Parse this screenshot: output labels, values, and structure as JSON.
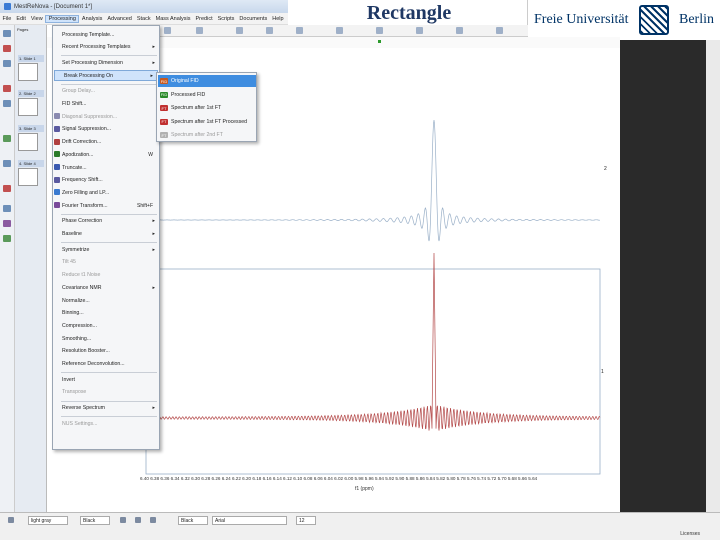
{
  "window": {
    "title": "MestReNova - [Document 1*]"
  },
  "slide_title": "Rectangle",
  "logo": {
    "left": "Freie Universität",
    "right": "Berlin"
  },
  "menubar": [
    "File",
    "Edit",
    "View",
    "Processing",
    "Analysis",
    "Advanced",
    "Stack",
    "Mass Analysis",
    "Predict",
    "Scripts",
    "Documents",
    "Help"
  ],
  "pages_header": "Pages",
  "pages": [
    "1. Slide 1",
    "2. Slide 2",
    "3. Slide 3",
    "4. Slide 4"
  ],
  "processing_menu": [
    {
      "label": "Processing Template...",
      "enabled": true
    },
    {
      "label": "Recent Processing Templates",
      "enabled": true,
      "submenu": true
    },
    {
      "label": "Set Processing Dimension",
      "enabled": true,
      "submenu": true
    },
    {
      "label": "Break Processing On",
      "enabled": true,
      "submenu": true,
      "highlighted": true
    },
    {
      "label": "Group Delay...",
      "enabled": false
    },
    {
      "label": "FID Shift...",
      "enabled": true
    },
    {
      "label": "Diagonal Suppression...",
      "enabled": false
    },
    {
      "label": "Signal Suppression...",
      "enabled": true
    },
    {
      "label": "Drift Correction...",
      "enabled": true
    },
    {
      "label": "Apodization...",
      "enabled": true,
      "shortcut": "W"
    },
    {
      "label": "Truncate...",
      "enabled": true
    },
    {
      "label": "Frequency Shift...",
      "enabled": true
    },
    {
      "label": "Zero Filling and LP...",
      "enabled": true
    },
    {
      "label": "Fourier Transform...",
      "enabled": true,
      "shortcut": "Shift+F"
    },
    {
      "label": "Phase Correction",
      "enabled": true,
      "submenu": true
    },
    {
      "label": "Baseline",
      "enabled": true,
      "submenu": true
    },
    {
      "label": "Symmetrize",
      "enabled": true,
      "submenu": true
    },
    {
      "label": "Tilt 45",
      "enabled": false
    },
    {
      "label": "Reduce t1 Noise",
      "enabled": false
    },
    {
      "label": "Covariance NMR",
      "enabled": true,
      "submenu": true
    },
    {
      "label": "Normalize...",
      "enabled": true
    },
    {
      "label": "Binning...",
      "enabled": true
    },
    {
      "label": "Compression...",
      "enabled": true
    },
    {
      "label": "Smoothing...",
      "enabled": true
    },
    {
      "label": "Resolution Booster...",
      "enabled": true
    },
    {
      "label": "Reference Deconvolution...",
      "enabled": true
    },
    {
      "label": "Invert",
      "enabled": true
    },
    {
      "label": "Transpose",
      "enabled": false
    },
    {
      "label": "Reverse Spectrum",
      "enabled": true,
      "submenu": true
    },
    {
      "label": "NUS Settings...",
      "enabled": false
    }
  ],
  "break_submenu": [
    {
      "label": "Original FID",
      "icon": "FID",
      "highlighted": true,
      "enabled": true
    },
    {
      "label": "Processed FID",
      "icon": "FID",
      "enabled": true
    },
    {
      "label": "Spectrum after 1st FT",
      "icon": "FT",
      "enabled": true
    },
    {
      "label": "Spectrum after 1st FT Processed",
      "icon": "FT",
      "enabled": true
    },
    {
      "label": "Spectrum after 2nd FT",
      "icon": "FT",
      "enabled": false
    }
  ],
  "spectrum": {
    "axis_ticks": "6.40 6.38 6.36 6.34 6.32 6.30 6.28 6.26 6.24 6.22 6.20 6.18 6.16 6.14 6.12 6.10 6.08 6.06 6.04 6.02 6.00 5.98 5.96 5.94 5.92 5.90 5.88 5.86 5.84 5.82 5.80 5.78 5.76 5.74 5.72 5.70 5.68 5.66 5.64",
    "axis_label": "f1 (ppm)",
    "trace_labels": [
      "2",
      "1"
    ],
    "upper_color": "#9ab0c8",
    "lower_color": "#b44a4a"
  },
  "bottom": {
    "color": "light gray",
    "style": "Black",
    "font": "Arial",
    "size": "12",
    "license": "Licenses"
  }
}
